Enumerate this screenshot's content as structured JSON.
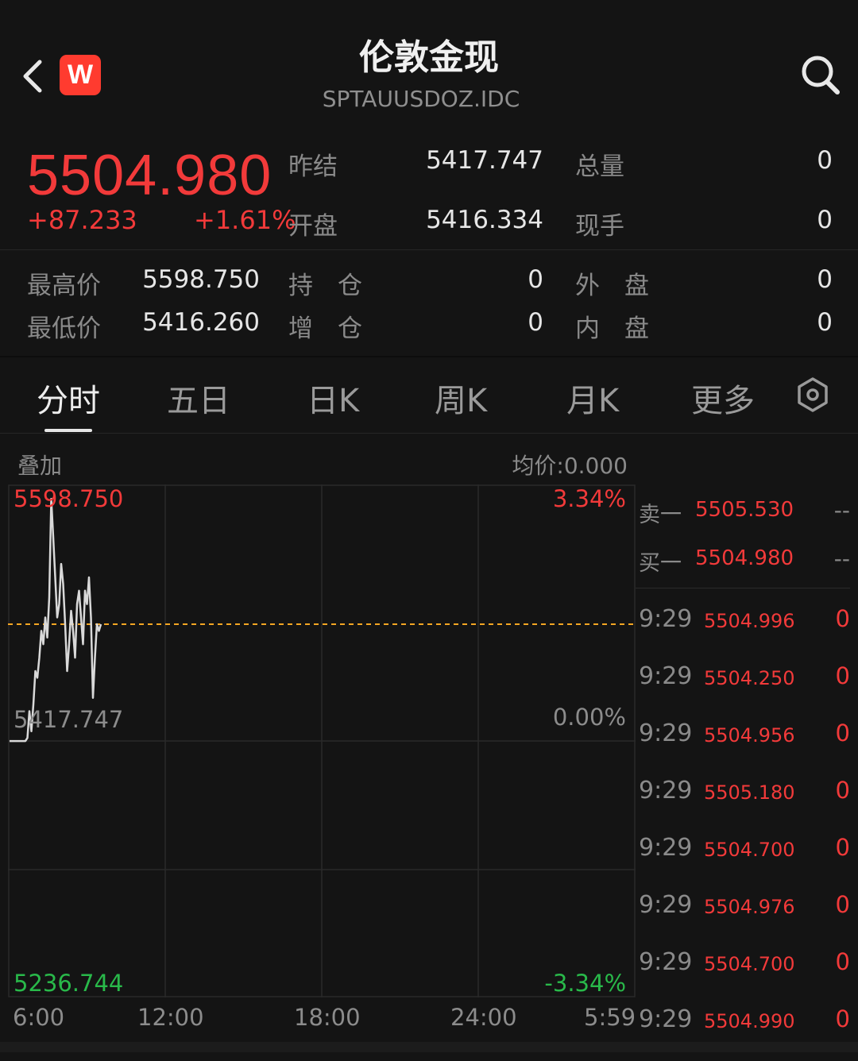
{
  "header": {
    "title": "伦敦金现",
    "code": "SPTAUUSDOZ.IDC",
    "logo_letter": "W"
  },
  "quote": {
    "price": "5504.980",
    "change": "+87.233",
    "change_pct": "+1.61%",
    "prev_close_label": "昨结",
    "prev_close": "5417.747",
    "open_label": "开盘",
    "open": "5416.334",
    "volume_label": "总量",
    "volume": "0",
    "current_hand_label": "现手",
    "current_hand": "0",
    "high_label": "最高价",
    "high": "5598.750",
    "low_label": "最低价",
    "low": "5416.260",
    "open_interest_label": "持　仓",
    "open_interest": "0",
    "oi_change_label": "增　仓",
    "oi_change": "0",
    "outer_label": "外　盘",
    "outer": "0",
    "inner_label": "内　盘",
    "inner": "0"
  },
  "tabs": [
    "分时",
    "五日",
    "日K",
    "周K",
    "月K",
    "更多"
  ],
  "active_tab": "分时",
  "chart": {
    "overlay_label": "叠加",
    "avg_label": "均价:0.000",
    "top_price": "5598.750",
    "mid_price": "5417.747",
    "bottom_price": "5236.744",
    "top_pct": "3.34%",
    "mid_pct": "0.00%",
    "bottom_pct": "-3.34%",
    "x_ticks": [
      "6:00",
      "12:00",
      "18:00",
      "24:00",
      "5:59"
    ]
  },
  "chart_data": {
    "type": "line",
    "ylim": [
      5236.744,
      5598.75
    ],
    "reference_line": 5417.747,
    "current_line": 5504.98,
    "x_ticks": [
      "6:00",
      "12:00",
      "18:00",
      "24:00",
      "5:59"
    ],
    "series": [
      {
        "values": [
          5417.7,
          5417.7,
          5417.7,
          5417.7,
          5417.7,
          5417.7,
          5417.7,
          5417.7,
          5417.7,
          5420,
          5440,
          5425,
          5445,
          5470,
          5465,
          5480,
          5500,
          5490,
          5510,
          5495,
          5525,
          5598.7,
          5570,
          5540,
          5510,
          5520,
          5550,
          5535,
          5505,
          5470,
          5490,
          5515,
          5500,
          5480,
          5520,
          5530,
          5510,
          5490,
          5530,
          5520,
          5540,
          5510,
          5450,
          5480,
          5505,
          5500,
          5504.98
        ]
      }
    ],
    "colors": {
      "line": "#d9d9d9",
      "current": "#f5a623",
      "up": "#f23a3a",
      "down": "#29b94a"
    }
  },
  "orderbook": {
    "ask_label": "卖一",
    "ask_price": "5505.530",
    "ask_vol": "--",
    "bid_label": "买一",
    "bid_price": "5504.980",
    "bid_vol": "--"
  },
  "ticks": [
    {
      "time": "9:29",
      "price": "5504.996",
      "vol": "0"
    },
    {
      "time": "9:29",
      "price": "5504.250",
      "vol": "0"
    },
    {
      "time": "9:29",
      "price": "5504.956",
      "vol": "0"
    },
    {
      "time": "9:29",
      "price": "5505.180",
      "vol": "0"
    },
    {
      "time": "9:29",
      "price": "5504.700",
      "vol": "0"
    },
    {
      "time": "9:29",
      "price": "5504.976",
      "vol": "0"
    },
    {
      "time": "9:29",
      "price": "5504.700",
      "vol": "0"
    },
    {
      "time": "9:29",
      "price": "5504.990",
      "vol": "0"
    }
  ]
}
